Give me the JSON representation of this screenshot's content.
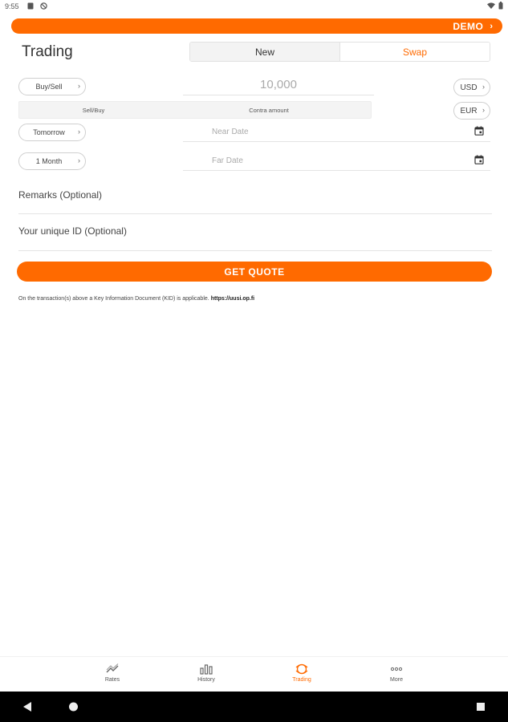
{
  "status_bar": {
    "time": "9:55"
  },
  "demo_banner": {
    "label": "DEMO",
    "chevron": "›"
  },
  "page_title": "Trading",
  "segments": {
    "new_label": "New",
    "swap_label": "Swap"
  },
  "form": {
    "buy_sell": "Buy/Sell",
    "amount_value": "10,000",
    "currency_1": "USD",
    "sell_buy": "Sell/Buy",
    "contra_amount": "Contra amount",
    "currency_2": "EUR",
    "near_tenor": "Tomorrow",
    "near_date_placeholder": "Near Date",
    "far_tenor": "1 Month",
    "far_date_placeholder": "Far Date",
    "remarks_label": "Remarks (Optional)",
    "unique_id_label": "Your unique ID (Optional)"
  },
  "quote_button": "GET QUOTE",
  "kid_note": {
    "text": "On the transaction(s) above a Key Information Document (KID) is applicable.",
    "link": "https://uusi.op.fi"
  },
  "bottom_nav": [
    {
      "label": "Rates",
      "icon": "rates-icon"
    },
    {
      "label": "History",
      "icon": "history-icon"
    },
    {
      "label": "Trading",
      "icon": "trading-icon",
      "active": true
    },
    {
      "label": "More",
      "icon": "more-icon"
    }
  ],
  "colors": {
    "accent": "#ff6a00",
    "text": "#333333",
    "placeholder": "#aaaaaa"
  }
}
